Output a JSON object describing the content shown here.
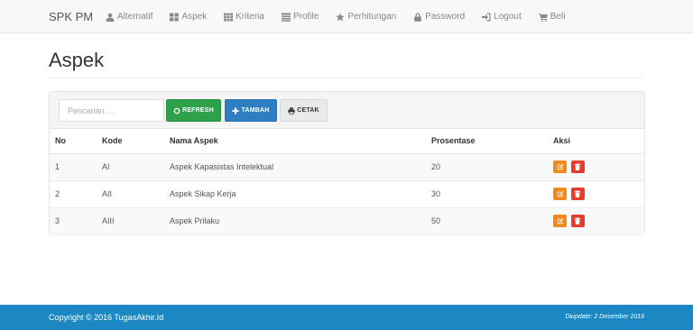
{
  "navbar": {
    "brand": "SPK PM",
    "items": [
      {
        "label": "Alternatif",
        "icon": "user-icon"
      },
      {
        "label": "Aspek",
        "icon": "th-large-icon"
      },
      {
        "label": "Kriteria",
        "icon": "th-icon"
      },
      {
        "label": "Profile",
        "icon": "list-icon"
      },
      {
        "label": "Perhitungan",
        "icon": "star-icon"
      },
      {
        "label": "Password",
        "icon": "lock-icon"
      },
      {
        "label": "Logout",
        "icon": "logout-icon"
      },
      {
        "label": "Beli",
        "icon": "cart-icon"
      }
    ]
  },
  "page": {
    "title": "Aspek"
  },
  "toolbar": {
    "search_placeholder": "Pencarian. . .",
    "refresh_label": "REFRESH",
    "tambah_label": "TAMBAH",
    "cetak_label": "CETAK"
  },
  "table": {
    "headers": [
      "No",
      "Kode",
      "Nama Aspek",
      "Prosentase",
      "Aksi"
    ],
    "rows": [
      {
        "no": "1",
        "kode": "AI",
        "nama": "Aspek Kapasistas Intelektual",
        "prosentase": "20"
      },
      {
        "no": "2",
        "kode": "AII",
        "nama": "Aspek Sikap Kerja",
        "prosentase": "30"
      },
      {
        "no": "3",
        "kode": "AIII",
        "nama": "Aspek Prilaku",
        "prosentase": "50"
      }
    ]
  },
  "footer": {
    "copyright": "Copyright © 2016 TugasAkhir.Id",
    "updated": "Diupdate: 2 Desember 2016"
  },
  "colors": {
    "refresh": "#2ea14a",
    "tambah": "#2f7ec1",
    "edit": "#f08a1c",
    "delete": "#e53c2c",
    "footer": "#1b88c4"
  }
}
